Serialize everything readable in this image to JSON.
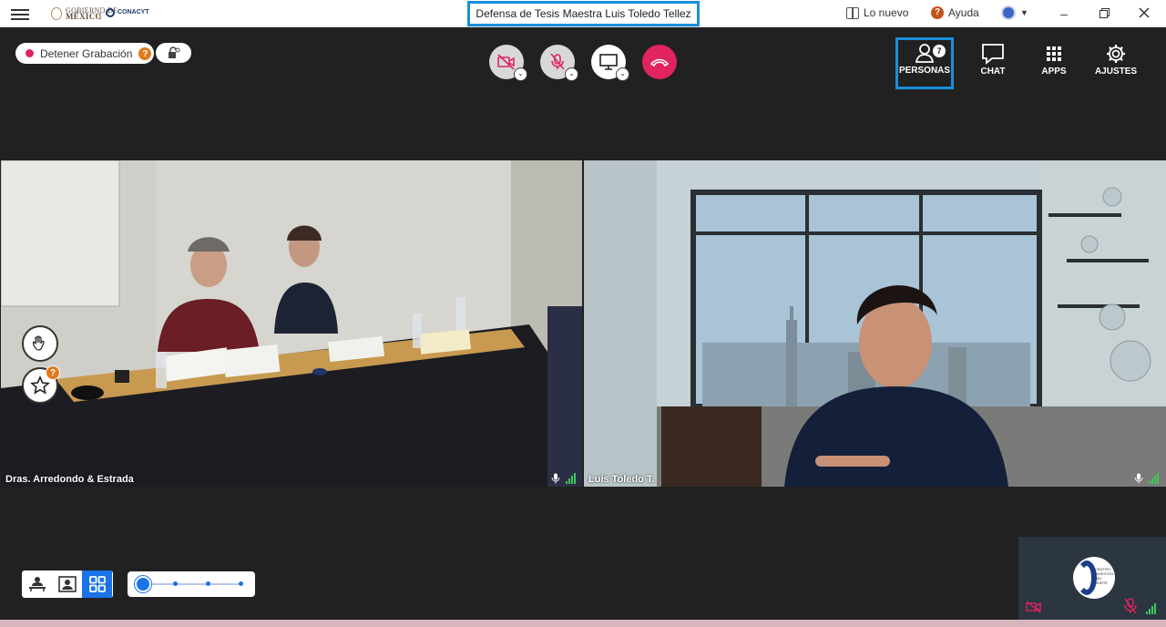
{
  "titlebar": {
    "gov_line1": "GOBIERNO DE",
    "gov_line2": "MÉXICO",
    "conacyt": "CONACYT",
    "meeting_title": "Defensa de Tesis Maestra Luis Toledo Tellez",
    "whats_new": "Lo nuevo",
    "help": "Ayuda"
  },
  "recording": {
    "label": "Detener Grabación",
    "badge": "?"
  },
  "toolbar": {
    "people_label": "PERSONAS",
    "people_count": "7",
    "chat_label": "CHAT",
    "apps_label": "APPS",
    "settings_label": "AJUSTES"
  },
  "tiles": [
    {
      "name": "Dras. Arredondo & Estrada"
    },
    {
      "name": "Luis Toledo T."
    }
  ],
  "reactions": {
    "badge": "?"
  },
  "mini_tile": {
    "logo_text": "CENTRO INVESTIGACIÓN DEL NORTE"
  }
}
